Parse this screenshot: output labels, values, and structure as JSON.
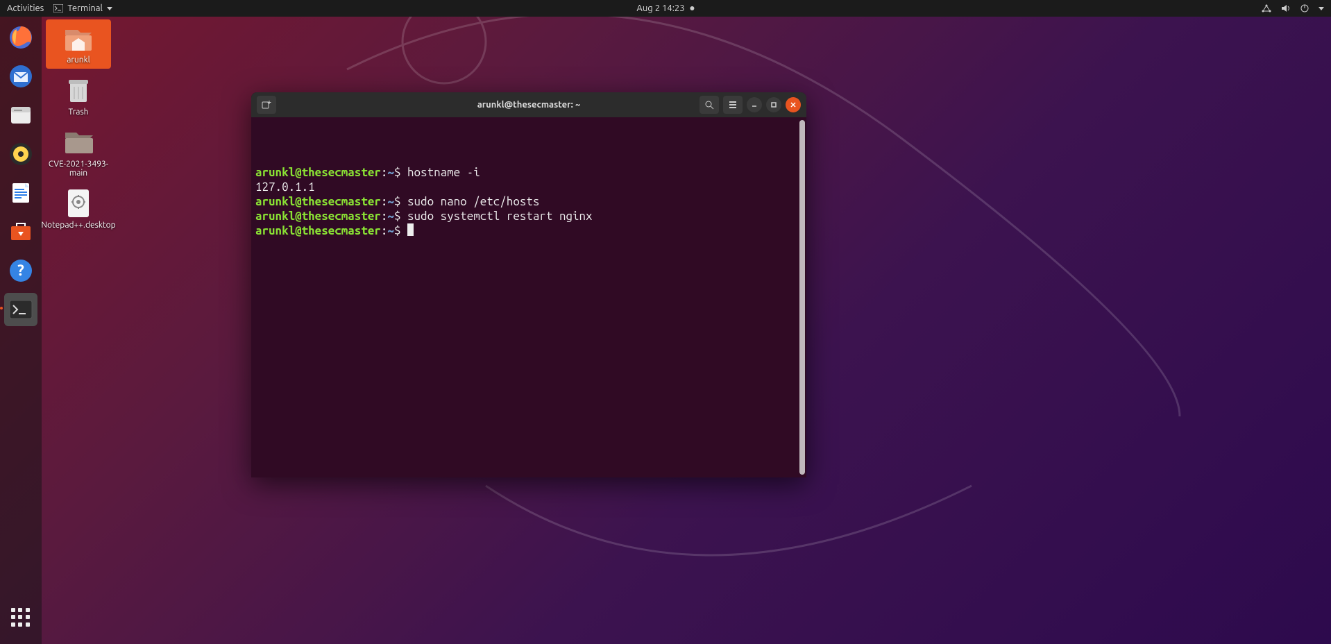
{
  "topbar": {
    "activities": "Activities",
    "app_label": "Terminal",
    "datetime": "Aug 2  14:23"
  },
  "dock": {
    "items": [
      {
        "name": "firefox"
      },
      {
        "name": "thunderbird"
      },
      {
        "name": "files"
      },
      {
        "name": "rhythmbox"
      },
      {
        "name": "libreoffice-writer"
      },
      {
        "name": "ubuntu-software"
      },
      {
        "name": "help"
      },
      {
        "name": "terminal"
      }
    ]
  },
  "desktop": {
    "icons": [
      {
        "label": "arunkl",
        "kind": "home",
        "selected": true
      },
      {
        "label": "Trash",
        "kind": "trash"
      },
      {
        "label": "CVE-2021-3493-main",
        "kind": "folder"
      },
      {
        "label": "Notepad++.desktop",
        "kind": "file"
      }
    ]
  },
  "terminal": {
    "title": "arunkl@thesecmaster: ~",
    "prompt_user": "arunkl@thesecmaster",
    "prompt_sep1": ":",
    "prompt_path": "~",
    "prompt_sep2": "$",
    "lines": [
      {
        "type": "cmd",
        "text": "hostname -i"
      },
      {
        "type": "output",
        "text": "127.0.1.1"
      },
      {
        "type": "cmd",
        "text": "sudo nano /etc/hosts"
      },
      {
        "type": "cmd",
        "text": "sudo systemctl restart nginx"
      },
      {
        "type": "prompt"
      }
    ]
  }
}
